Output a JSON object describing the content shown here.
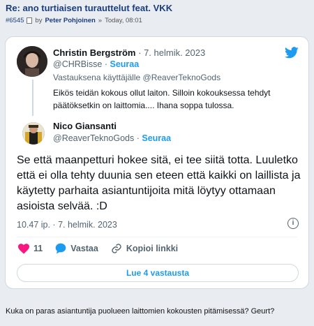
{
  "post": {
    "title": "Re: ano turtiaisen turauttelut feat. VKK",
    "number": "#6545",
    "by": "by",
    "author": "Peter Pohjoinen",
    "separator": "»",
    "time": "Today, 08:01"
  },
  "tweet1": {
    "name": "Christin Bergström",
    "dot": "·",
    "date": "7. helmik. 2023",
    "handle": "@CHRBisse",
    "follow": "Seuraa",
    "reply_prefix": "Vastauksena käyttäjälle",
    "reply_to": "@ReaverTeknoGods",
    "body": "Eikös teidän kokous ollut laiton. Silloin kokouksessa tehdyt päätöksetkin on laittomia.... Ihana soppa tulossa."
  },
  "tweet2": {
    "name": "Nico Giansanti",
    "handle": "@ReaverTeknoGods",
    "dot": "·",
    "follow": "Seuraa",
    "body": "Se että maanpetturi hokee sitä, ei tee siitä totta. Luuletko että ei olla tehty duunia sen eteen että kaikki on laillista ja käytetty parhaita asiantuntijoita mitä löytyy ottamaan asioista selvää. :D",
    "timestamp": "10.47 ip. · 7. helmik. 2023",
    "info": "i"
  },
  "actions": {
    "likes": "11",
    "reply": "Vastaa",
    "copy_link": "Kopioi linkki"
  },
  "read_replies": "Lue 4 vastausta",
  "footer": "Kuka on paras asiantuntija puolueen laittomien kokousten pitämisessä? Geurt?",
  "colors": {
    "accent": "#1d9bf0",
    "like": "#f91880",
    "title": "#1a3d7c"
  },
  "icons": [
    "twitter-bird-icon",
    "heart-icon",
    "speech-bubble-icon",
    "link-icon",
    "info-icon",
    "document-icon"
  ]
}
